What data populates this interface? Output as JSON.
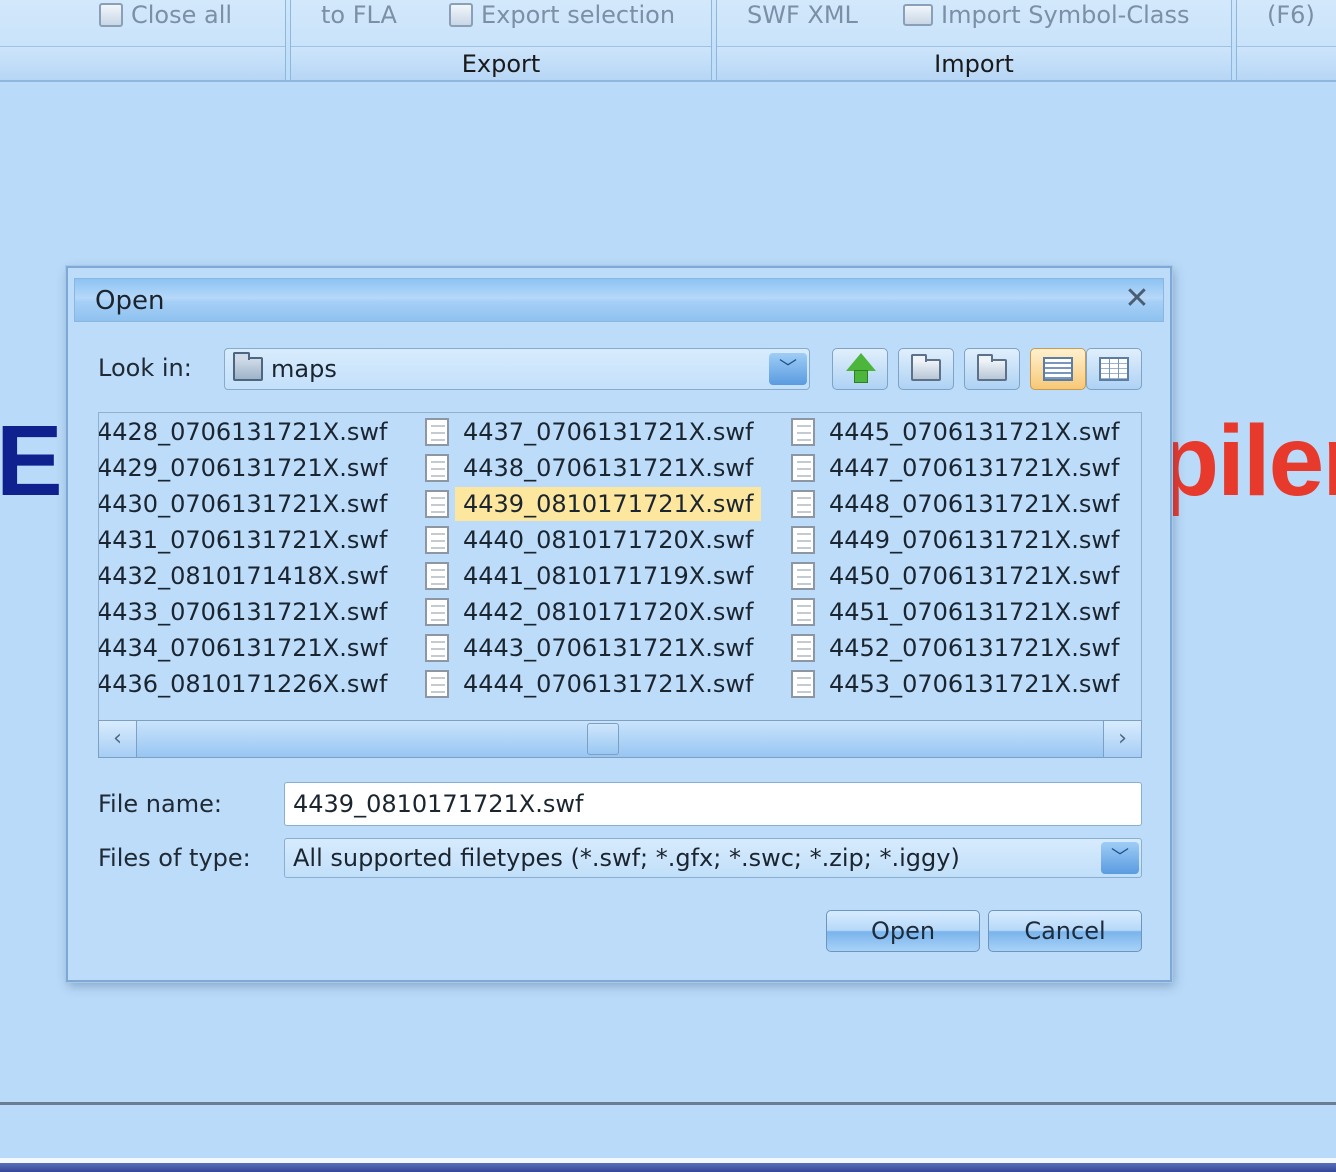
{
  "ribbon": {
    "buttons": {
      "close_all": "Close all",
      "to_fla": "to FLA",
      "export_selection": "Export selection",
      "swf_xml": "SWF XML",
      "import_symbol_class": "Import Symbol-Class",
      "f6": "(F6)"
    },
    "groups": {
      "export": "Export",
      "import": "Import"
    }
  },
  "background": {
    "left_text": "E",
    "right_text": "piler"
  },
  "dialog": {
    "title": "Open",
    "look_in_label": "Look in:",
    "look_in_value": "maps",
    "files": [
      "4428_0706131721X.swf",
      "4429_0706131721X.swf",
      "4430_0706131721X.swf",
      "4431_0706131721X.swf",
      "4432_0810171418X.swf",
      "4433_0706131721X.swf",
      "4434_0706131721X.swf",
      "4436_0810171226X.swf",
      "4437_0706131721X.swf",
      "4438_0706131721X.swf",
      "4439_0810171721X.swf",
      "4440_0810171720X.swf",
      "4441_0810171719X.swf",
      "4442_0810171720X.swf",
      "4443_0706131721X.swf",
      "4444_0706131721X.swf",
      "4445_0706131721X.swf",
      "4447_0706131721X.swf",
      "4448_0706131721X.swf",
      "4449_0706131721X.swf",
      "4450_0706131721X.swf",
      "4451_0706131721X.swf",
      "4452_0706131721X.swf",
      "4453_0706131721X.swf"
    ],
    "selected_file": "4439_0810171721X.swf",
    "file_name_label": "File name:",
    "file_name_value": "4439_0810171721X.swf",
    "files_of_type_label": "Files of type:",
    "files_of_type_value": "All supported filetypes (*.swf; *.gfx; *.swc; *.zip; *.iggy)",
    "open_button": "Open",
    "cancel_button": "Cancel"
  },
  "icons": {
    "close": "close-icon",
    "folder": "folder-icon",
    "up_folder": "up-folder-icon",
    "home": "home-icon",
    "new_folder": "new-folder-icon",
    "list_view": "list-view-icon",
    "details_view": "details-view-icon",
    "file": "file-icon"
  },
  "colors": {
    "background": "#b9daf8",
    "selection": "#fde79f",
    "brand_blue": "#0f208f",
    "brand_red": "#e8392d"
  }
}
